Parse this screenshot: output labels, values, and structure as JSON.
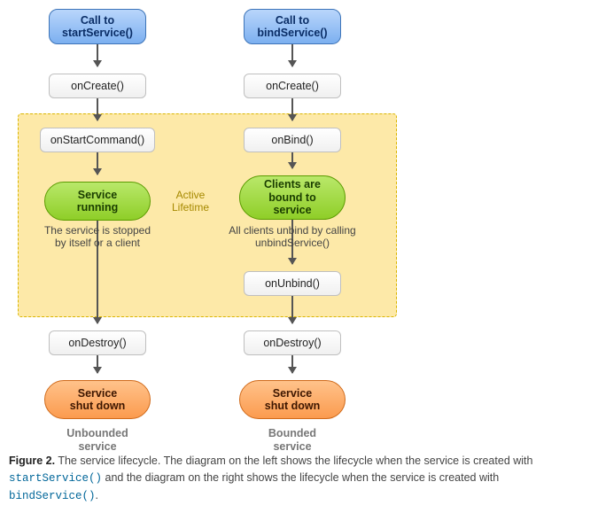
{
  "left": {
    "start": "Call to\nstartService()",
    "onCreate": "onCreate()",
    "onStartCommand": "onStartCommand()",
    "running": "Service\nrunning",
    "stoppedNote": "The service is stopped\nby itself or a client",
    "onDestroy": "onDestroy()",
    "shutdown": "Service\nshut down",
    "label": "Unbounded\nservice"
  },
  "right": {
    "start": "Call to\nbindService()",
    "onCreate": "onCreate()",
    "onBind": "onBind()",
    "boundState": "Clients are\nbound to\nservice",
    "unbindNote": "All clients unbind by calling\nunbindService()",
    "onUnbind": "onUnbind()",
    "onDestroy": "onDestroy()",
    "shutdown": "Service\nshut down",
    "label": "Bounded\nservice"
  },
  "activeLifetime": "Active\nLifetime",
  "caption": {
    "figureLabel": "Figure 2.",
    "textA": " The service lifecycle. The diagram on the left shows the lifecycle when the service is created with ",
    "codeA": "startService()",
    "textB": " and the diagram on the right shows the lifecycle when the service is created with ",
    "codeB": "bindService()",
    "textC": "."
  },
  "chart_data": {
    "type": "flow-diagram",
    "flows": [
      {
        "name": "Unbounded service",
        "nodes": [
          {
            "id": "call_startService",
            "label": "Call to startService()",
            "kind": "entry"
          },
          {
            "id": "onCreate_L",
            "label": "onCreate()",
            "kind": "method"
          },
          {
            "id": "onStartCommand",
            "label": "onStartCommand()",
            "kind": "method"
          },
          {
            "id": "running",
            "label": "Service running",
            "kind": "state"
          },
          {
            "id": "onDestroy_L",
            "label": "onDestroy()",
            "kind": "method"
          },
          {
            "id": "shutdown_L",
            "label": "Service shut down",
            "kind": "terminal"
          }
        ],
        "edges": [
          [
            "call_startService",
            "onCreate_L"
          ],
          [
            "onCreate_L",
            "onStartCommand"
          ],
          [
            "onStartCommand",
            "running"
          ],
          [
            "running",
            "onDestroy_L",
            "The service is stopped by itself or a client"
          ],
          [
            "onDestroy_L",
            "shutdown_L"
          ]
        ]
      },
      {
        "name": "Bounded service",
        "nodes": [
          {
            "id": "call_bindService",
            "label": "Call to bindService()",
            "kind": "entry"
          },
          {
            "id": "onCreate_R",
            "label": "onCreate()",
            "kind": "method"
          },
          {
            "id": "onBind",
            "label": "onBind()",
            "kind": "method"
          },
          {
            "id": "boundState",
            "label": "Clients are bound to service",
            "kind": "state"
          },
          {
            "id": "onUnbind",
            "label": "onUnbind()",
            "kind": "method"
          },
          {
            "id": "onDestroy_R",
            "label": "onDestroy()",
            "kind": "method"
          },
          {
            "id": "shutdown_R",
            "label": "Service shut down",
            "kind": "terminal"
          }
        ],
        "edges": [
          [
            "call_bindService",
            "onCreate_R"
          ],
          [
            "onCreate_R",
            "onBind"
          ],
          [
            "onBind",
            "boundState"
          ],
          [
            "boundState",
            "onUnbind",
            "All clients unbind by calling unbindService()"
          ],
          [
            "onUnbind",
            "onDestroy_R"
          ],
          [
            "onDestroy_R",
            "shutdown_R"
          ]
        ]
      }
    ],
    "region": {
      "label": "Active Lifetime",
      "contains": [
        "onStartCommand",
        "running",
        "onBind",
        "boundState",
        "onUnbind"
      ]
    }
  }
}
